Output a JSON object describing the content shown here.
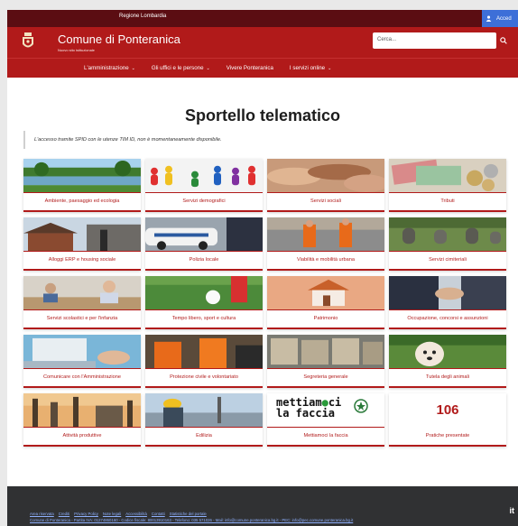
{
  "topbar": {
    "region": "Regione Lombardia",
    "login": "Acced"
  },
  "header": {
    "title": "Comune di Ponteranica",
    "subtitle": "Nuovo sito istituzionale",
    "search_placeholder": "Cerca..."
  },
  "nav": [
    {
      "label": "L'amministrazione",
      "chevron": "⌄"
    },
    {
      "label": "Gli uffici e le persone",
      "chevron": "⌄"
    },
    {
      "label": "Vivere Ponteranica",
      "chevron": ""
    },
    {
      "label": "I servizi online",
      "chevron": "⌄"
    }
  ],
  "main": {
    "title": "Sportello telematico",
    "notice": "L'accesso tramite SPID con le utenze TIM ID, non è momentaneamente disponibile."
  },
  "cards": [
    {
      "label": "Ambiente, paesaggio ed ecologia",
      "icon": "lake-photo"
    },
    {
      "label": "Servizi demografici",
      "icon": "people-figures-photo"
    },
    {
      "label": "Servizi sociali",
      "icon": "hands-photo"
    },
    {
      "label": "Tributi",
      "icon": "euro-money-photo"
    },
    {
      "label": "Alloggi ERP e housing sociale",
      "icon": "houses-photo"
    },
    {
      "label": "Polizia locale",
      "icon": "police-car-photo"
    },
    {
      "label": "Viabilità e mobilità urbana",
      "icon": "road-works-photo"
    },
    {
      "label": "Servizi cimiteriali",
      "icon": "cemetery-photo"
    },
    {
      "label": "Servizi scolastici e per l'infanzia",
      "icon": "classroom-photo"
    },
    {
      "label": "Tempo libero, sport e cultura",
      "icon": "football-photo"
    },
    {
      "label": "Patrimonio",
      "icon": "house-model-photo"
    },
    {
      "label": "Occupazione, concorsi e assunzioni",
      "icon": "handshake-photo"
    },
    {
      "label": "Comunicare con l'Amministrazione",
      "icon": "laptop-photo"
    },
    {
      "label": "Protezione civile e volontariato",
      "icon": "rescuers-photo"
    },
    {
      "label": "Segreteria generale",
      "icon": "archive-photo"
    },
    {
      "label": "Tutela degli animali",
      "icon": "dog-photo"
    },
    {
      "label": "Attività produttive",
      "icon": "factory-photo"
    },
    {
      "label": "Edilizia",
      "icon": "builder-photo"
    },
    {
      "label": "Mettiamoci la faccia",
      "icon": "mettiamoci-logo",
      "logo_text": [
        "mettiamoci",
        "la faccia"
      ]
    },
    {
      "label": "Pratiche presentate",
      "icon": "counter",
      "count": "106"
    }
  ],
  "footer": {
    "links": [
      "Area riservata",
      "Crediti",
      "Privacy Policy",
      "Note legali",
      "Accessibilità",
      "Contatti",
      "Statistiche del portale"
    ],
    "info": "Comune di Ponteranica - Partita IVA: 01274860160 - Codice fiscale: 80013910163 - Telefono: 035 571026 - Mail: info@comune.ponteranica.bg.it - PEC: info@pec.comune.ponteranica.bg.it",
    "tag": "it"
  },
  "colors": {
    "brand": "#b11a1a",
    "topbar": "#5b0d12",
    "login": "#3d6fd8",
    "footer": "#303133"
  }
}
